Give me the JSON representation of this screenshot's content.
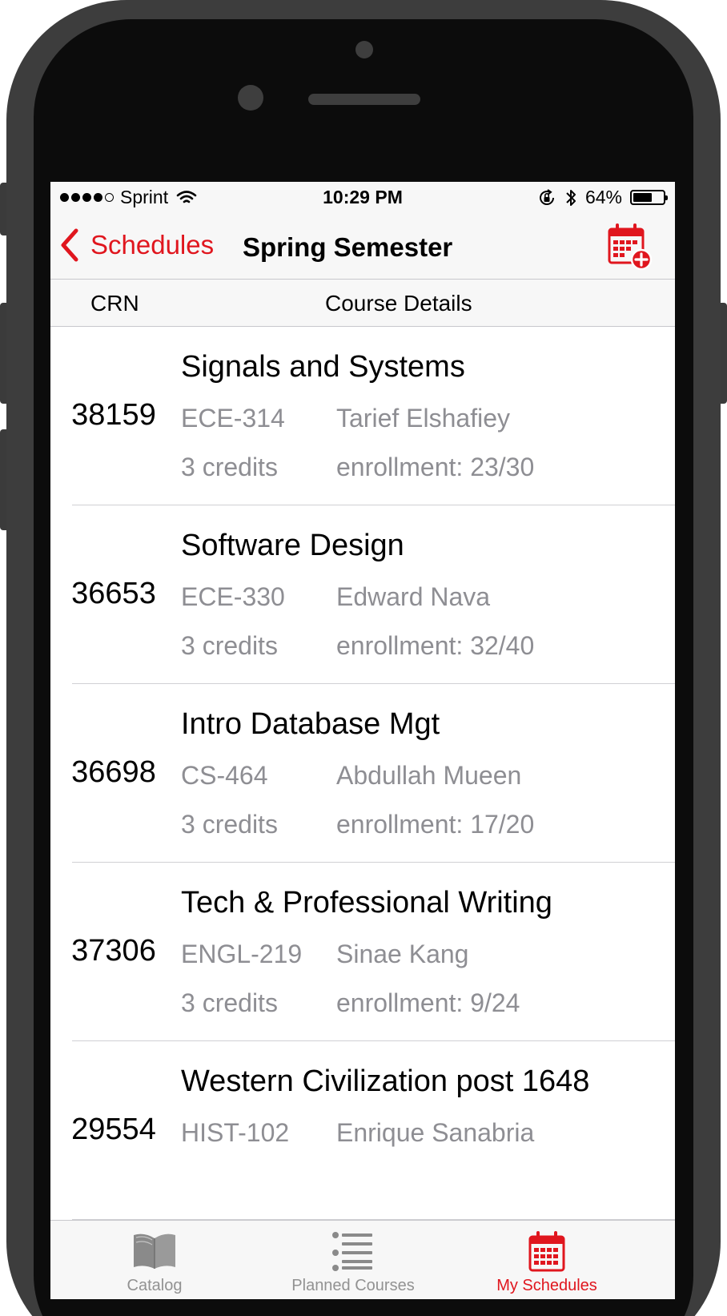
{
  "status_bar": {
    "carrier": "Sprint",
    "time": "10:29 PM",
    "battery_percent": "64%",
    "battery_level": 0.64,
    "signal_bars": 4
  },
  "nav": {
    "back_label": "Schedules",
    "title": "Spring Semester",
    "add_icon": "calendar-add-icon"
  },
  "columns": {
    "crn": "CRN",
    "details": "Course Details"
  },
  "courses": [
    {
      "crn": "38159",
      "title": "Signals and Systems",
      "code": "ECE-314",
      "instructor": "Tarief Elshafiey",
      "credits": "3 credits",
      "enrollment": "enrollment: 23/30"
    },
    {
      "crn": "36653",
      "title": "Software Design",
      "code": "ECE-330",
      "instructor": "Edward Nava",
      "credits": "3 credits",
      "enrollment": "enrollment: 32/40"
    },
    {
      "crn": "36698",
      "title": "Intro Database Mgt",
      "code": "CS-464",
      "instructor": "Abdullah Mueen",
      "credits": "3 credits",
      "enrollment": "enrollment: 17/20"
    },
    {
      "crn": "37306",
      "title": "Tech & Professional Writing",
      "code": "ENGL-219",
      "instructor": "Sinae Kang",
      "credits": "3 credits",
      "enrollment": "enrollment: 9/24"
    },
    {
      "crn": "29554",
      "title": "Western Civilization post 1648",
      "code": "HIST-102",
      "instructor": "Enrique Sanabria",
      "credits": "",
      "enrollment": ""
    }
  ],
  "tabs": [
    {
      "label": "Catalog",
      "icon": "book-icon",
      "active": false
    },
    {
      "label": "Planned Courses",
      "icon": "list-icon",
      "active": false
    },
    {
      "label": "My Schedules",
      "icon": "calendar-icon",
      "active": true
    }
  ],
  "colors": {
    "accent": "#e0161e",
    "inactive_tab": "#929292",
    "secondary_text": "#8e8e93",
    "bar_background": "#f7f7f7"
  }
}
